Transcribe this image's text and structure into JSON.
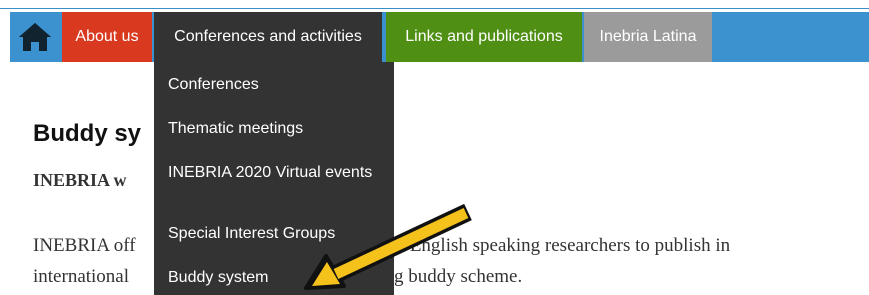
{
  "nav": {
    "home_icon": "home-icon",
    "items": [
      {
        "label": "About us"
      },
      {
        "label": "Conferences and activities"
      },
      {
        "label": "Links and publications"
      },
      {
        "label": "Inebria Latina"
      }
    ]
  },
  "dropdown": {
    "items": [
      {
        "label": "Conferences"
      },
      {
        "label": "Thematic meetings"
      },
      {
        "label": "INEBRIA 2020 Virtual events"
      },
      {
        "label": "Special Interest Groups"
      },
      {
        "label": "Buddy system"
      }
    ]
  },
  "content": {
    "heading_visible": "Buddy sy",
    "subheading_visible": "INEBRIA w",
    "para_line1_left": "INEBRIA off",
    "para_line1_right": "n-English speaking researchers to publish in",
    "para_line2_left": "international",
    "para_line2_right": "g buddy scheme."
  },
  "colors": {
    "nav_blue": "#3c92cf",
    "about_red": "#d9391f",
    "conf_dark": "#333333",
    "links_green": "#4f8f14",
    "latina_gray": "#9b9b9b",
    "arrow_yellow": "#f5c21b"
  },
  "annotation": {
    "arrow_icon": "arrow-pointer-icon"
  }
}
